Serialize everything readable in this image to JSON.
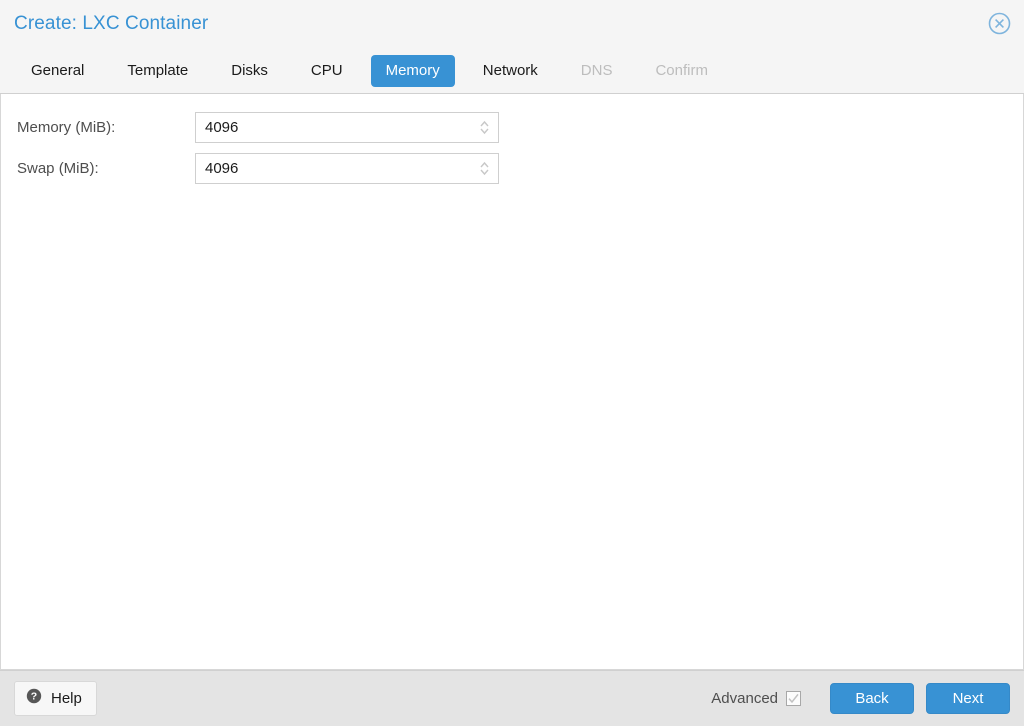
{
  "window": {
    "title": "Create: LXC Container",
    "close_icon": "close-circle-icon"
  },
  "tabs": [
    {
      "label": "General",
      "state": "normal"
    },
    {
      "label": "Template",
      "state": "normal"
    },
    {
      "label": "Disks",
      "state": "normal"
    },
    {
      "label": "CPU",
      "state": "normal"
    },
    {
      "label": "Memory",
      "state": "active"
    },
    {
      "label": "Network",
      "state": "normal"
    },
    {
      "label": "DNS",
      "state": "disabled"
    },
    {
      "label": "Confirm",
      "state": "disabled"
    }
  ],
  "form": {
    "fields": [
      {
        "label": "Memory (MiB):",
        "value": "4096",
        "placeholder": ""
      },
      {
        "label": "Swap (MiB):",
        "value": "4096",
        "placeholder": ""
      }
    ]
  },
  "footer": {
    "help_label": "Help",
    "help_icon": "question-mark-circle-icon",
    "advanced_label": "Advanced",
    "advanced_checked": true,
    "back_label": "Back",
    "next_label": "Next"
  },
  "colors": {
    "accent": "#3892d4",
    "title": "#3892d4",
    "header_bg": "#f5f5f5",
    "body_bg": "#ffffff",
    "footer_bg": "#e4e4e4",
    "disabled_text": "#bdbdbd"
  }
}
